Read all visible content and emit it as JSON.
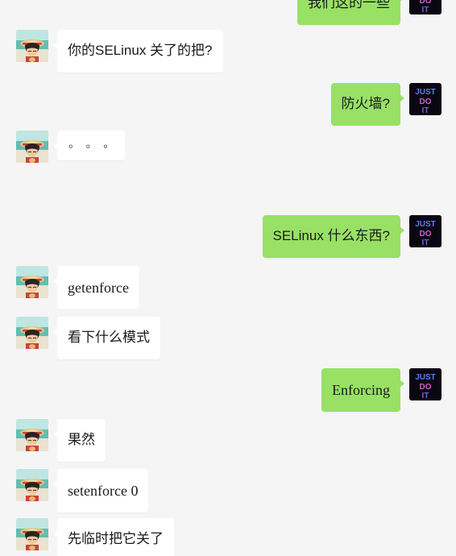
{
  "app": {
    "name": "wechat-chat-thread",
    "background_color": "#f5f5f5",
    "incoming_bubble_color": "#ffffff",
    "outgoing_bubble_color": "#98e165",
    "text_color": "#1a1a1a"
  },
  "avatars": {
    "incoming_name": "luffy-straw-hat-avatar",
    "outgoing_name": "just-do-it-neon-avatar",
    "outgoing_lines": [
      "JUST",
      "DO",
      "IT"
    ]
  },
  "messages": [
    {
      "id": "m0",
      "side": "right",
      "text": "我们这的一些",
      "clipped": true,
      "note": "partially cut off at top edge"
    },
    {
      "id": "m1",
      "side": "left",
      "text": "你的SELinux 关了的把?"
    },
    {
      "id": "m2",
      "side": "right",
      "text": "防火墙?"
    },
    {
      "id": "m3",
      "side": "left",
      "text": "。。。",
      "kind": "dots"
    },
    {
      "id": "m4",
      "side": "right",
      "text": "SELinux 什么东西?"
    },
    {
      "id": "m5",
      "side": "left",
      "text": "getenforce"
    },
    {
      "id": "m6",
      "side": "left",
      "text": "看下什么模式"
    },
    {
      "id": "m7",
      "side": "right",
      "text": "Enforcing"
    },
    {
      "id": "m8",
      "side": "left",
      "text": "果然"
    },
    {
      "id": "m9",
      "side": "left",
      "text": "setenforce 0"
    },
    {
      "id": "m10",
      "side": "left",
      "text": "先临时把它关了",
      "clipped": true,
      "note": "partially cut off at bottom edge"
    }
  ]
}
